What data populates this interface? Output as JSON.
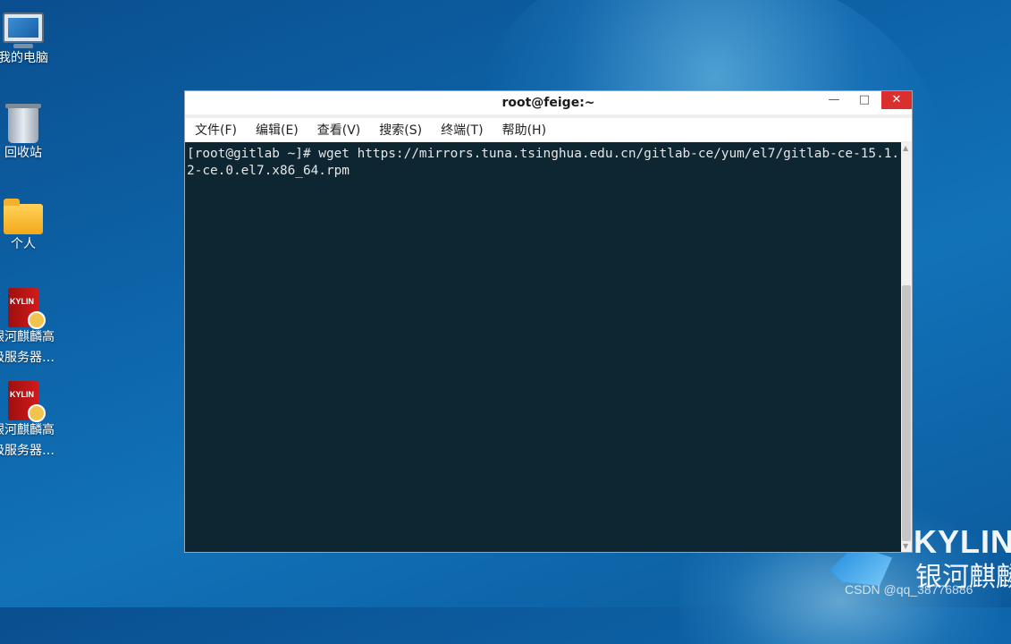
{
  "desktop": {
    "icons": [
      {
        "label": "我的电脑",
        "icon": "computer-icon"
      },
      {
        "label": "回收站",
        "icon": "trash-icon"
      },
      {
        "label": "个人",
        "icon": "home-folder-icon"
      },
      {
        "label_line1": "银河麒麟高",
        "label_line2": "级服务器…",
        "badge": "KYLIN",
        "icon": "kylin-book-icon"
      },
      {
        "label_line1": "银河麒麟高",
        "label_line2": "级服务器…",
        "badge": "KYLIN",
        "icon": "kylin-book-icon"
      }
    ],
    "brand_text": "KYLIN",
    "brand_cn": "银河麒麟",
    "watermark": "CSDN @qq_38776886"
  },
  "window": {
    "title": "root@feige:~",
    "minimize_glyph": "—",
    "maximize_glyph": "□",
    "close_glyph": "✕",
    "menu": [
      "文件(F)",
      "编辑(E)",
      "查看(V)",
      "搜索(S)",
      "终端(T)",
      "帮助(H)"
    ],
    "terminal_text": "[root@gitlab ~]# wget https://mirrors.tuna.tsinghua.edu.cn/gitlab-ce/yum/el7/gitlab-ce-15.1.2-ce.0.el7.x86_64.rpm"
  },
  "colors": {
    "desktop_bg": "#0d63a8",
    "terminal_bg": "#0e2631",
    "close_button": "#d9302f"
  }
}
